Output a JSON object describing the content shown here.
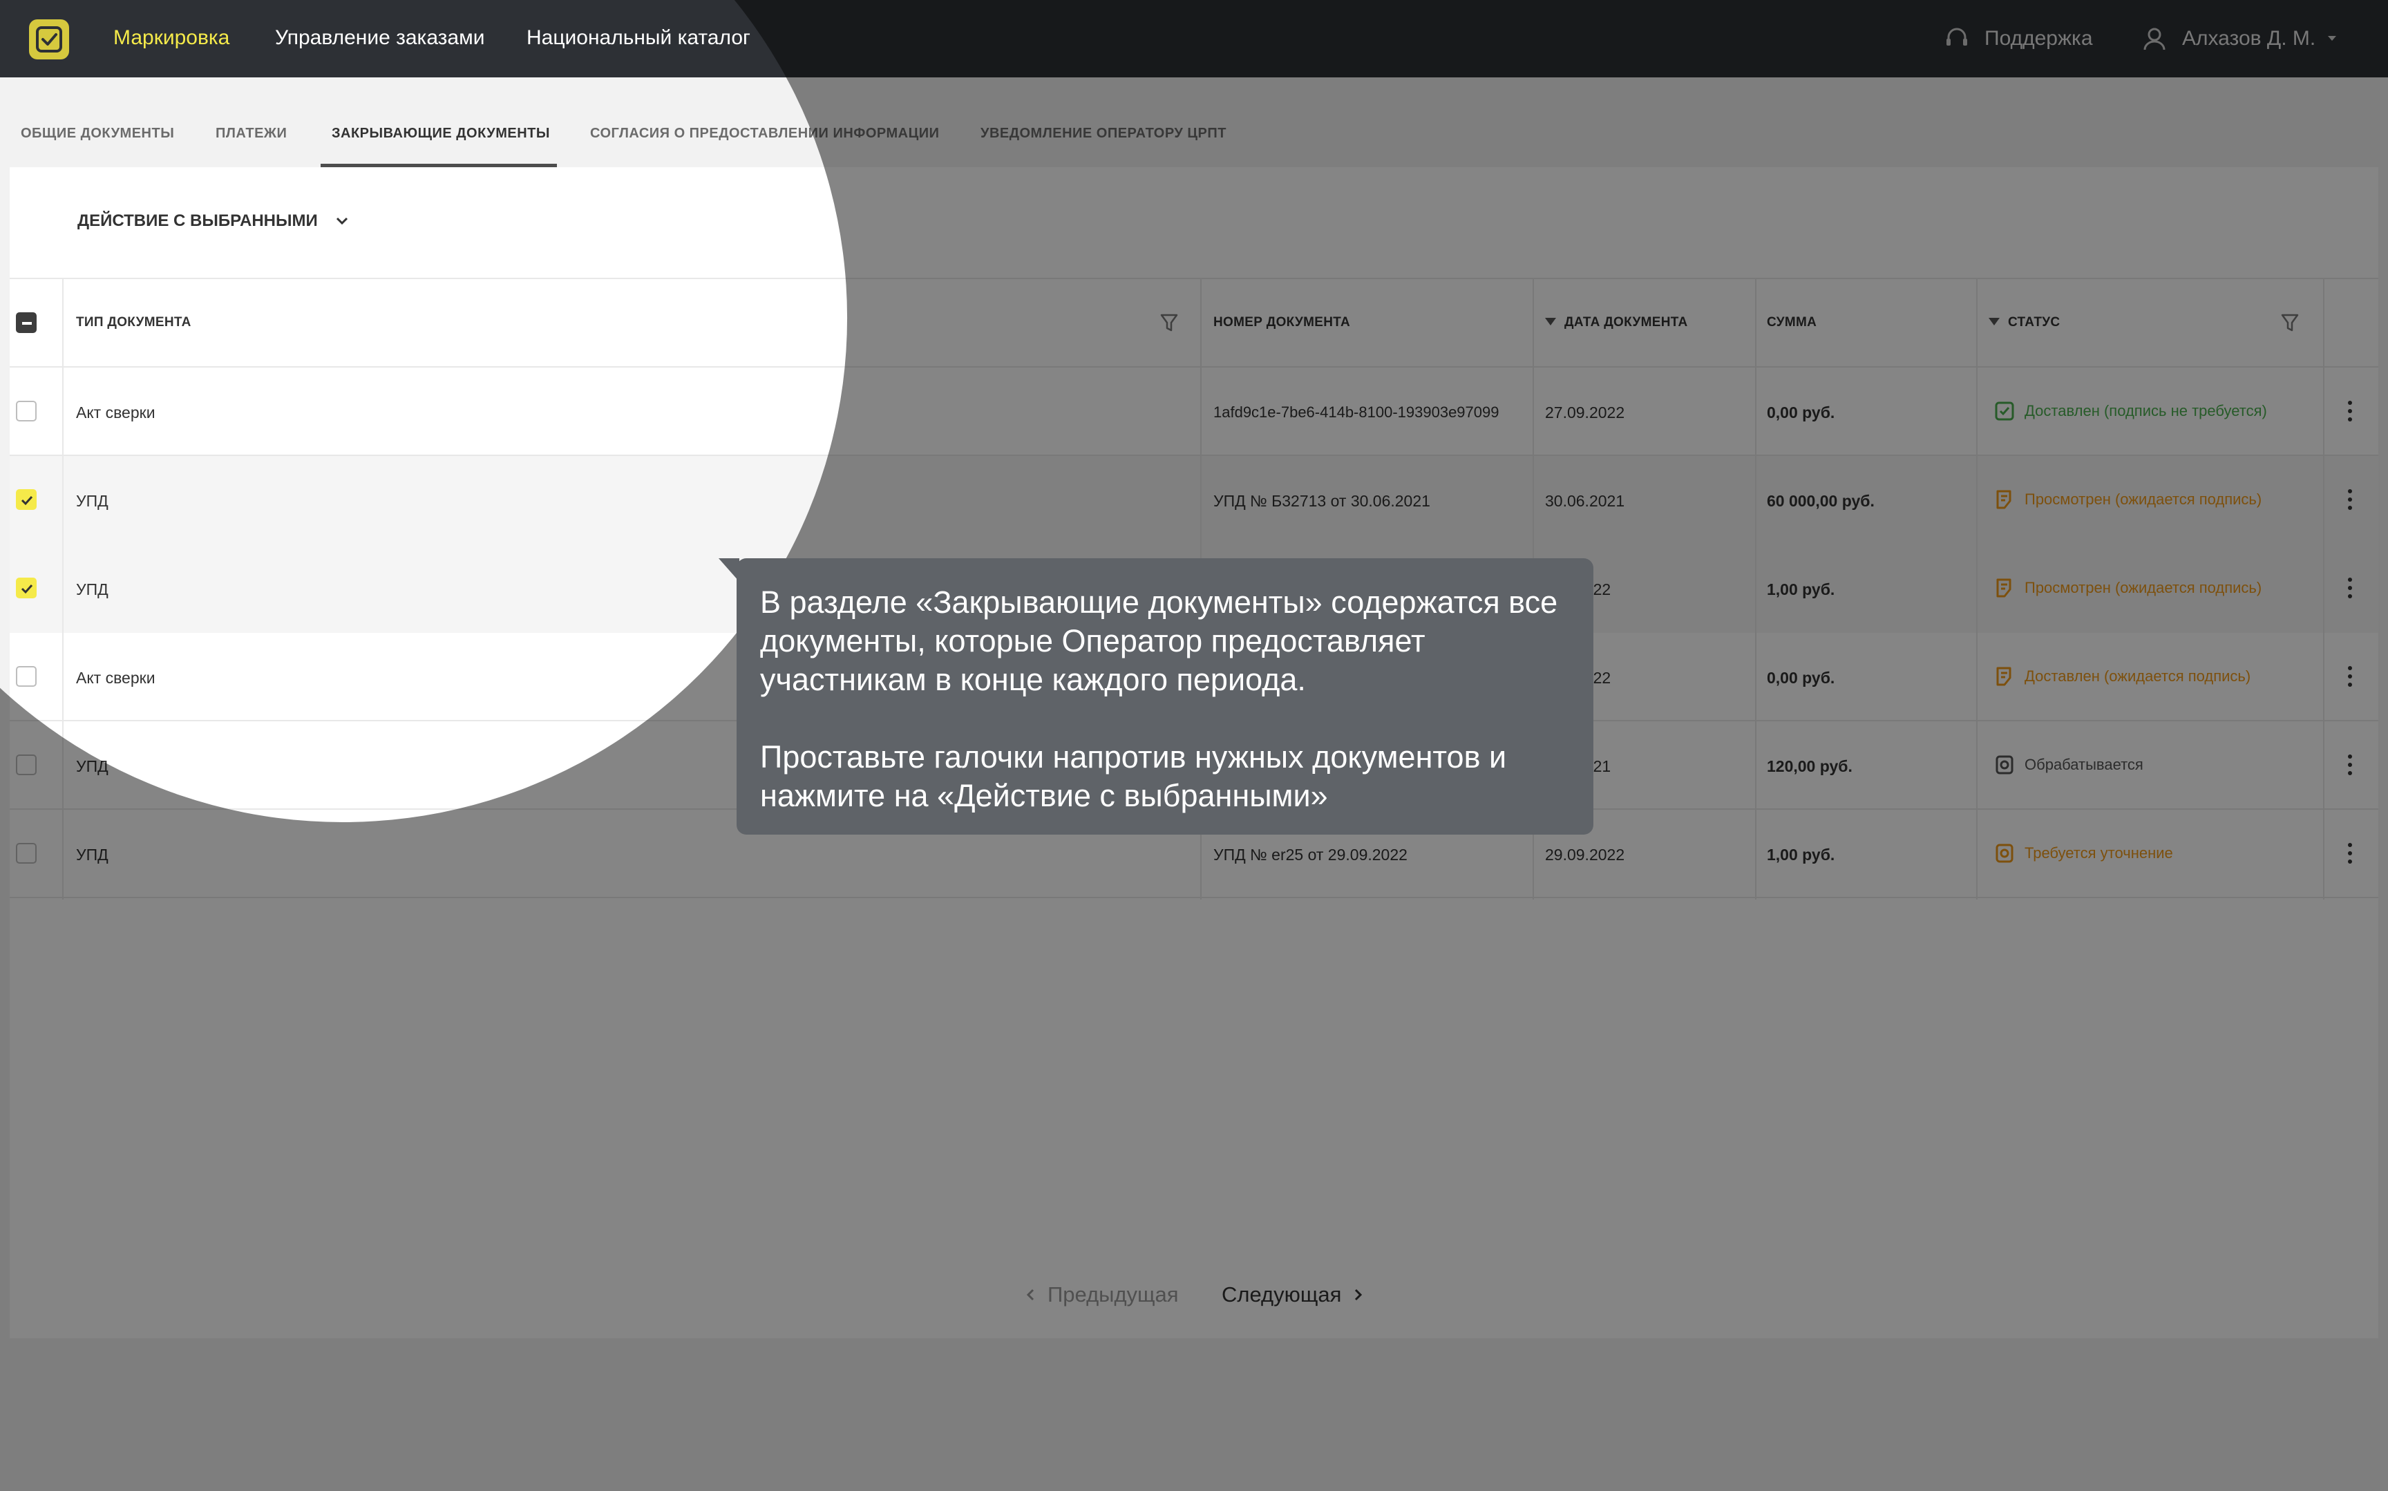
{
  "nav": {
    "items": [
      "Маркировка",
      "Управление заказами",
      "Национальный каталог"
    ],
    "support": "Поддержка",
    "user": "Алхазов Д. М."
  },
  "tabs": [
    "ОБЩИЕ ДОКУМЕНТЫ",
    "ПЛАТЕЖИ",
    "ЗАКРЫВАЮЩИЕ ДОКУМЕНТЫ",
    "СОГЛАСИЯ О ПРЕДОСТАВЛЕНИИ ИНФОРМАЦИИ",
    "УВЕДОМЛЕНИЕ ОПЕРАТОРУ ЦРПТ"
  ],
  "action_label": "ДЕЙСТВИЕ С ВЫБРАННЫМИ",
  "table": {
    "headers": [
      "ТИП ДОКУМЕНТА",
      "НОМЕР ДОКУМЕНТА",
      "ДАТА ДОКУМЕНТА",
      "СУММА",
      "СТАТУС"
    ],
    "rows": [
      {
        "type": "Акт сверки",
        "number": "1afd9c1e-7be6-414b-8100-193903e97099",
        "date": "27.09.2022",
        "sum": "0,00 руб.",
        "status": "Доставлен (подпись не требуется)",
        "checked": false
      },
      {
        "type": "УПД",
        "number": "УПД № Б32713 от 30.06.2021",
        "date": "30.06.2021",
        "sum": "60 000,00 руб.",
        "status": "Просмотрен (ожидается подпись)",
        "checked": true
      },
      {
        "type": "УПД",
        "number": "",
        "date": "2022",
        "sum": "1,00 руб.",
        "status": "Просмотрен (ожидается подпись)",
        "checked": true
      },
      {
        "type": "Акт сверки",
        "number": "",
        "date": "2022",
        "sum": "0,00 руб.",
        "status": "Доставлен (ожидается подпись)",
        "checked": false
      },
      {
        "type": "УПД",
        "number": "",
        "date": "2021",
        "sum": "120,00 руб.",
        "status": "Обрабатывается",
        "checked": false
      },
      {
        "type": "УПД",
        "number": "УПД № er25 от 29.09.2022",
        "date": "29.09.2022",
        "sum": "1,00 руб.",
        "status": "Требуется уточнение",
        "checked": false
      }
    ]
  },
  "pager": {
    "prev": "Предыдущая",
    "next": "Следующая"
  },
  "tooltip": {
    "p1": "В разделе «Закрывающие документы» содержатся все документы, которые Оператор предоставляет участникам в конце каждого периода.",
    "p2": "Проставьте галочки напротив нужных документов и нажмите на  «Действие с выбранными»"
  },
  "colors": {
    "topbar": "#2d3035",
    "accent_yellow": "#f5ea4a",
    "status_green": "#4caf50",
    "status_orange": "#f09a1a",
    "status_gray": "#555555",
    "tooltip_bg": "#5f6368"
  }
}
